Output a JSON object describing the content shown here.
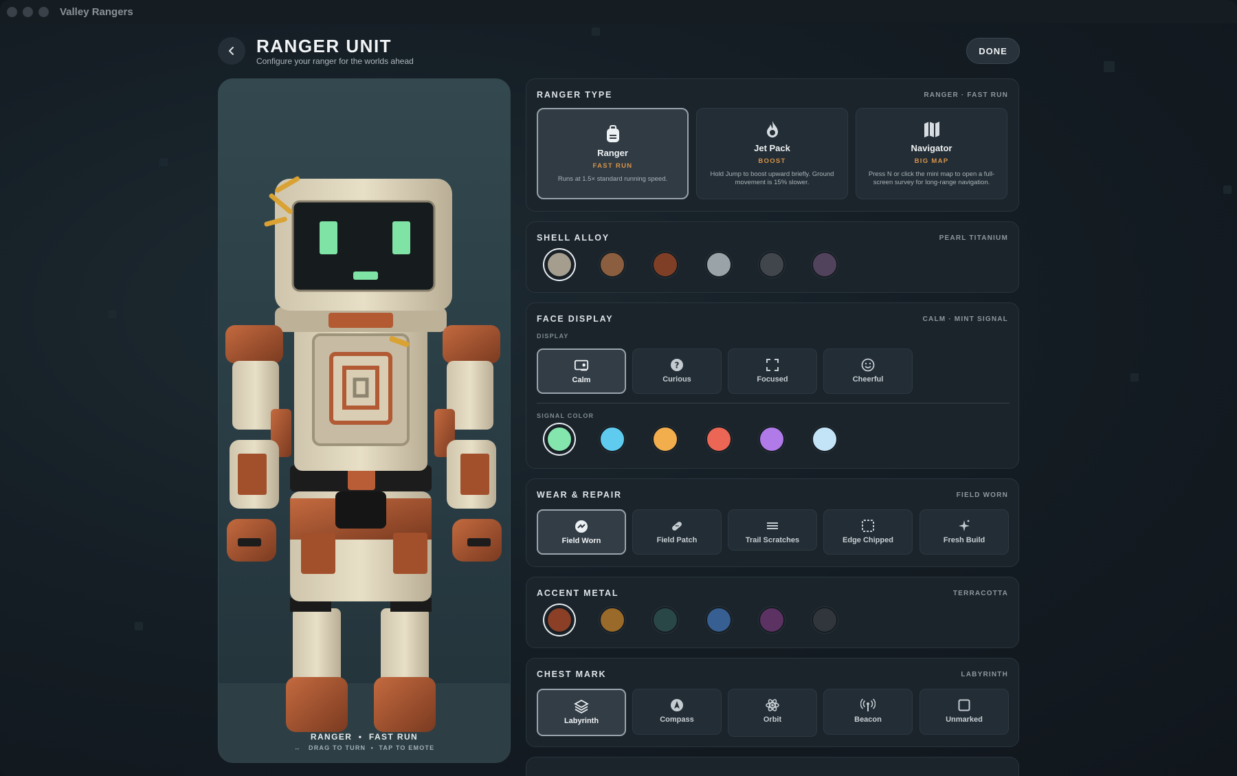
{
  "app": {
    "title": "Valley Rangers"
  },
  "header": {
    "title": "RANGER UNIT",
    "subtitle": "Configure your ranger for the worlds ahead",
    "done_label": "DONE"
  },
  "preview": {
    "caption_left": "RANGER",
    "caption_right": "FAST RUN",
    "hint_left": "DRAG TO TURN",
    "hint_right": "TAP TO EMOTE"
  },
  "ranger_type": {
    "title": "RANGER TYPE",
    "value": "RANGER · FAST RUN",
    "options": [
      {
        "name": "Ranger",
        "tag": "FAST RUN",
        "desc": "Runs at 1.5× standard running speed.",
        "icon": "backpack-icon",
        "selected": true
      },
      {
        "name": "Jet Pack",
        "tag": "BOOST",
        "desc": "Hold Jump to boost upward briefly. Ground movement is 15% slower.",
        "icon": "flame-icon",
        "selected": false
      },
      {
        "name": "Navigator",
        "tag": "BIG MAP",
        "desc": "Press N or click the mini map to open a full-screen survey for long-range navigation.",
        "icon": "map-icon",
        "selected": false
      }
    ]
  },
  "shell_alloy": {
    "title": "SHELL ALLOY",
    "value": "PEARL TITANIUM",
    "swatches": [
      "#a59e8f",
      "#8a5e3e",
      "#7e3f26",
      "#9aa3a8",
      "#40464c",
      "#52435c"
    ],
    "selected_index": 0
  },
  "face_display": {
    "title": "FACE DISPLAY",
    "value": "CALM · MINT SIGNAL",
    "display_label": "DISPLAY",
    "displays": [
      {
        "label": "Calm",
        "icon": "calm-display-icon",
        "selected": true
      },
      {
        "label": "Curious",
        "icon": "question-icon",
        "selected": false
      },
      {
        "label": "Focused",
        "icon": "focus-frame-icon",
        "selected": false
      },
      {
        "label": "Cheerful",
        "icon": "smile-icon",
        "selected": false
      }
    ],
    "signal_label": "SIGNAL COLOR",
    "signal_colors": [
      "#84e6ad",
      "#5fcbee",
      "#f2ad4c",
      "#eb6654",
      "#b07ae8",
      "#c3e3f6"
    ],
    "selected_index": 0
  },
  "wear_repair": {
    "title": "WEAR & REPAIR",
    "value": "FIELD WORN",
    "options": [
      {
        "label": "Field Worn",
        "icon": "worn-badge-icon",
        "selected": true
      },
      {
        "label": "Field Patch",
        "icon": "bandage-icon",
        "selected": false
      },
      {
        "label": "Trail Scratches",
        "icon": "scratches-icon",
        "selected": false
      },
      {
        "label": "Edge Chipped",
        "icon": "dashed-square-icon",
        "selected": false
      },
      {
        "label": "Fresh Build",
        "icon": "sparkle-icon",
        "selected": false
      }
    ]
  },
  "accent_metal": {
    "title": "ACCENT METAL",
    "value": "TERRACOTTA",
    "swatches": [
      "#8a3f26",
      "#9a6a2b",
      "#2a4747",
      "#375f91",
      "#5c3263",
      "#31363c"
    ],
    "selected_index": 0
  },
  "chest_mark": {
    "title": "CHEST MARK",
    "value": "LABYRINTH",
    "options": [
      {
        "label": "Labyrinth",
        "icon": "layers-icon",
        "selected": true
      },
      {
        "label": "Compass",
        "icon": "compass-icon",
        "selected": false
      },
      {
        "label": "Orbit",
        "icon": "atom-icon",
        "selected": false
      },
      {
        "label": "Beacon",
        "icon": "broadcast-icon",
        "selected": false
      },
      {
        "label": "Unmarked",
        "icon": "empty-square-icon",
        "selected": false
      }
    ]
  }
}
